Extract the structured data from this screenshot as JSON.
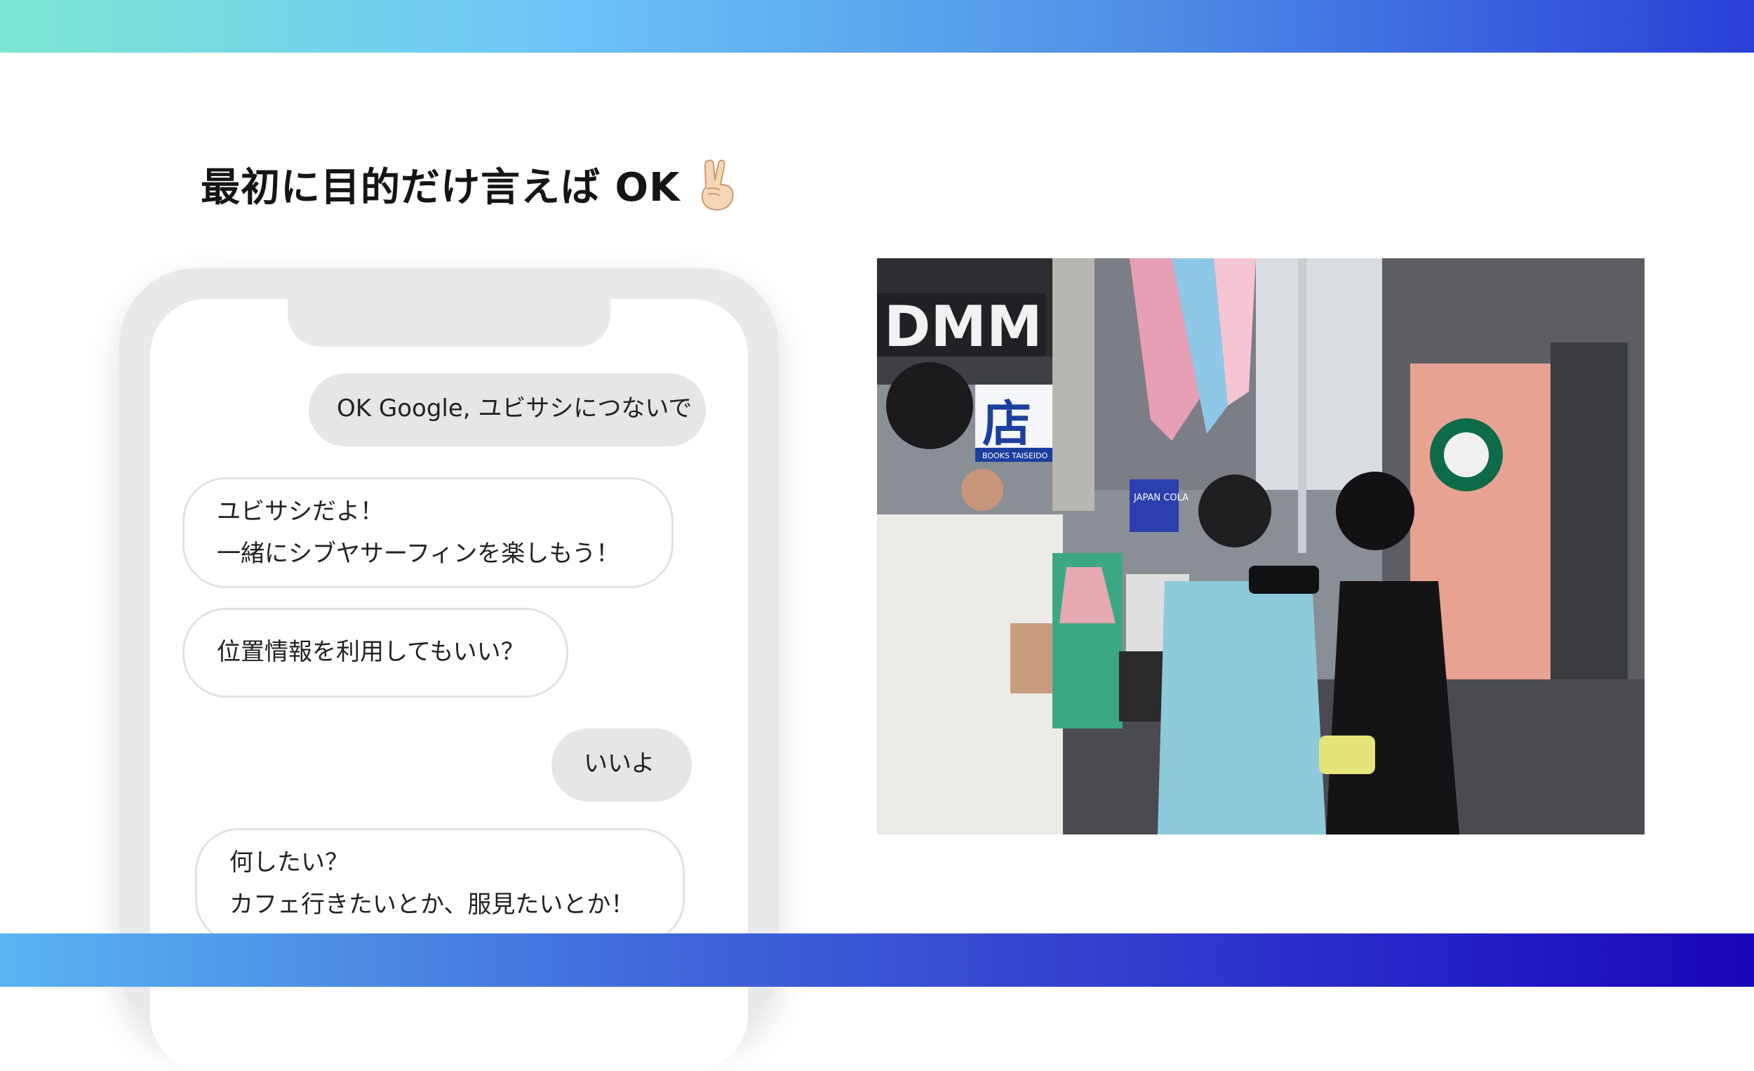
{
  "slide": {
    "title": "最初に目的だけ言えば OK"
  },
  "chat": {
    "messages": [
      {
        "sender": "user",
        "lines": [
          "OK Google, ユビサシにつないで"
        ]
      },
      {
        "sender": "assistant",
        "lines": [
          "ユビサシだよ！",
          "一緒にシブヤサーフィンを楽しもう！"
        ]
      },
      {
        "sender": "assistant",
        "lines": [
          "位置情報を利用してもいい？"
        ]
      },
      {
        "sender": "user",
        "lines": [
          "いいよ"
        ]
      },
      {
        "sender": "assistant",
        "lines": [
          "何したい？",
          "カフェ行きたいとか、服見たいとか！"
        ]
      }
    ]
  },
  "photo": {
    "signs": [
      "DMM",
      "店",
      "BOOKS TAISEIDO",
      "JAPAN COLA"
    ]
  },
  "colors": {
    "band_top_start": "#7de6d2",
    "band_top_end": "#2a3fd6",
    "band_bottom_start": "#5ab4f1",
    "band_bottom_end": "#1a06b8",
    "bubble_user": "#e6e6e9",
    "phone_frame": "#e9e9eb"
  },
  "icons": [
    "peace-hand-icon"
  ]
}
